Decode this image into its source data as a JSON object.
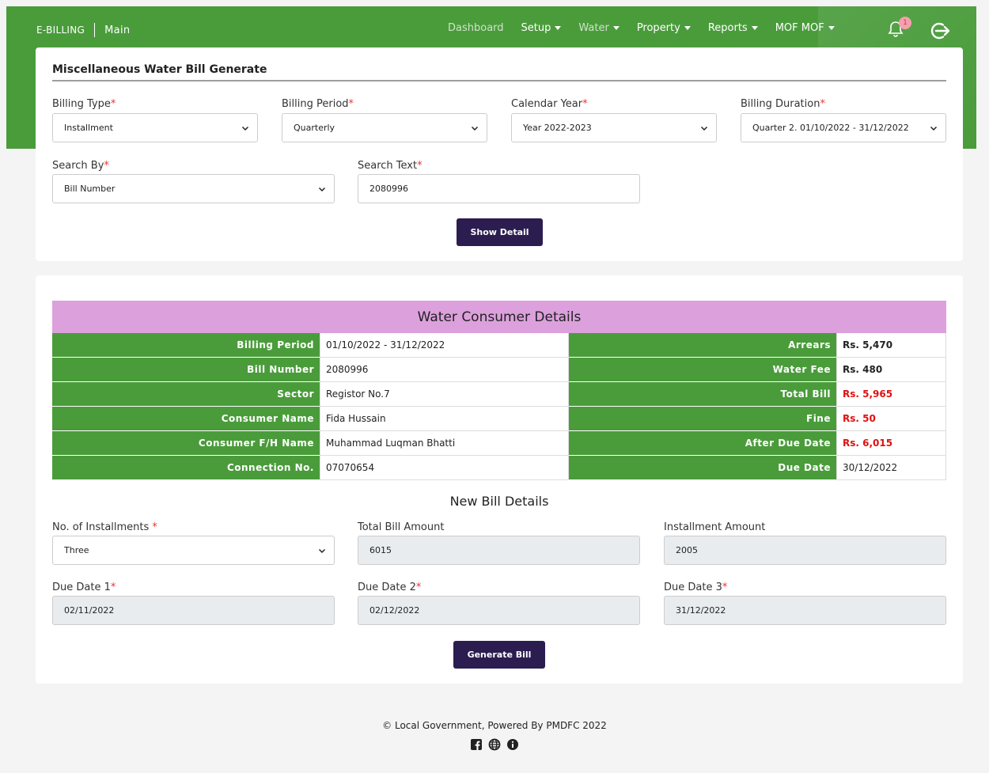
{
  "nav": {
    "brand": "E-BILLING",
    "section": "Main",
    "items": [
      {
        "label": "Dashboard",
        "dropdown": false,
        "dim": true
      },
      {
        "label": "Setup",
        "dropdown": true,
        "dim": false
      },
      {
        "label": "Water",
        "dropdown": true,
        "dim": true
      },
      {
        "label": "Property",
        "dropdown": true,
        "dim": false
      },
      {
        "label": "Reports",
        "dropdown": true,
        "dim": false
      },
      {
        "label": "MOF MOF",
        "dropdown": true,
        "dim": false
      }
    ],
    "notification_count": "1"
  },
  "form": {
    "title": "Miscellaneous Water Bill Generate",
    "billing_type": {
      "label": "Billing Type",
      "value": "Installment"
    },
    "billing_period": {
      "label": "Billing Period",
      "value": "Quarterly"
    },
    "calendar_year": {
      "label": "Calendar Year",
      "value": "Year 2022-2023"
    },
    "billing_duration": {
      "label": "Billing Duration",
      "value": "Quarter 2. 01/10/2022 - 31/12/2022"
    },
    "search_by": {
      "label": "Search By",
      "value": "Bill Number"
    },
    "search_text": {
      "label": "Search Text",
      "value": "2080996"
    },
    "show_detail": "Show Detail",
    "required_mark": "*"
  },
  "consumer": {
    "title": "Water Consumer Details",
    "left": [
      {
        "label": "Billing Period",
        "value": "01/10/2022 - 31/12/2022"
      },
      {
        "label": "Bill Number",
        "value": "2080996"
      },
      {
        "label": "Sector",
        "value": "Registor No.7"
      },
      {
        "label": "Consumer Name",
        "value": "Fida Hussain"
      },
      {
        "label": "Consumer F/H Name",
        "value": "Muhammad Luqman Bhatti"
      },
      {
        "label": "Connection No.",
        "value": "07070654"
      }
    ],
    "right": [
      {
        "label": "Arrears",
        "value": "Rs. 5,470",
        "style": "bold"
      },
      {
        "label": "Water Fee",
        "value": "Rs. 480",
        "style": "bold"
      },
      {
        "label": "Total Bill",
        "value": "Rs. 5,965",
        "style": "red"
      },
      {
        "label": "Fine",
        "value": "Rs. 50",
        "style": "red"
      },
      {
        "label": "After Due Date",
        "value": "Rs. 6,015",
        "style": "red"
      },
      {
        "label": "Due Date",
        "value": "30/12/2022",
        "style": ""
      }
    ]
  },
  "new_bill": {
    "title": "New Bill Details",
    "installments": {
      "label": "No. of Installments",
      "value": "Three"
    },
    "total_amount": {
      "label": "Total Bill Amount",
      "value": "6015"
    },
    "installment_amount": {
      "label": "Installment Amount",
      "value": "2005"
    },
    "due_date_1": {
      "label": "Due Date 1",
      "value": "02/11/2022"
    },
    "due_date_2": {
      "label": "Due Date 2",
      "value": "02/12/2022"
    },
    "due_date_3": {
      "label": "Due Date 3",
      "value": "31/12/2022"
    },
    "generate": "Generate Bill"
  },
  "footer": {
    "text": "© Local Government, Powered By PMDFC 2022",
    "icons": [
      "facebook-icon",
      "globe-icon",
      "info-icon"
    ]
  },
  "colors": {
    "green": "#4a9c3b",
    "header_pink": "#dca0dc",
    "button": "#2b1d4f",
    "red": "#e01010"
  }
}
